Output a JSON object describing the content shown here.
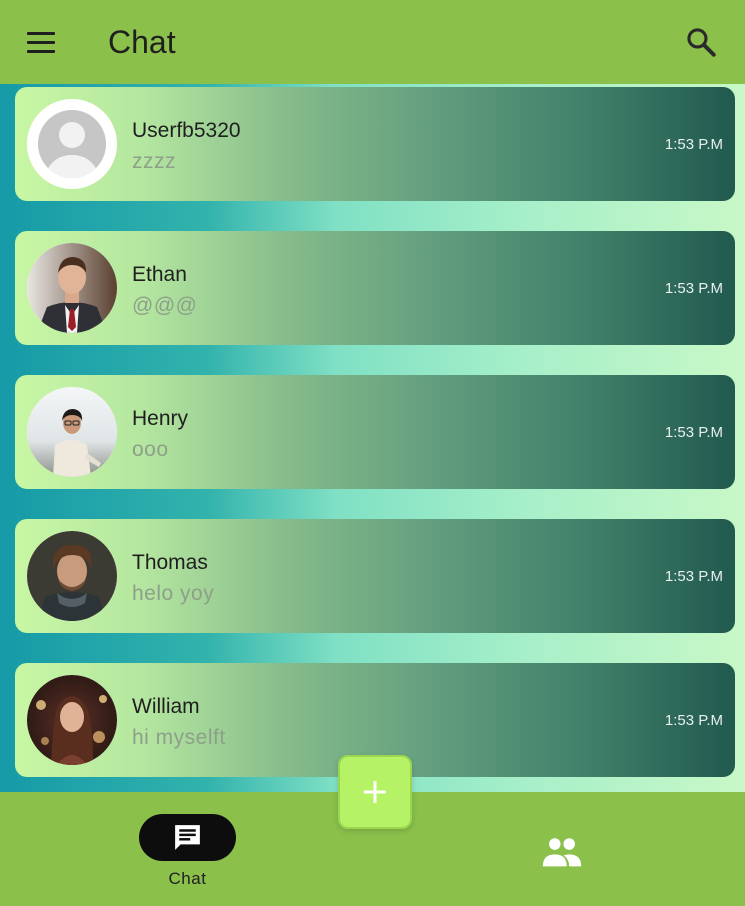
{
  "app_bar": {
    "title": "Chat",
    "menu_icon": "menu-icon",
    "search_icon": "search-icon"
  },
  "chats": [
    {
      "name": "Userfb5320",
      "message": "zzzz",
      "time": "1:53 P.M",
      "avatar": "default-avatar"
    },
    {
      "name": "Ethan",
      "message": "@@@",
      "time": "1:53 P.M",
      "avatar": "photo-man-suit"
    },
    {
      "name": "Henry",
      "message": "ooo",
      "time": "1:53 P.M",
      "avatar": "photo-person-glasses"
    },
    {
      "name": "Thomas",
      "message": "helo yoy",
      "time": "1:53 P.M",
      "avatar": "photo-man-beard"
    },
    {
      "name": "William",
      "message": "hi myselft",
      "time": "1:53 P.M",
      "avatar": "photo-woman"
    }
  ],
  "fab": {
    "icon": "plus-icon"
  },
  "bottom_nav": {
    "items": [
      {
        "label": "Chat",
        "icon": "chat-icon",
        "selected": true
      },
      {
        "label": "",
        "icon": "people-icon",
        "selected": false
      }
    ]
  },
  "colors": {
    "app_bar": "#8bc04b",
    "fab": "#b5f266",
    "nav_indicator": "#0d0d0d"
  }
}
